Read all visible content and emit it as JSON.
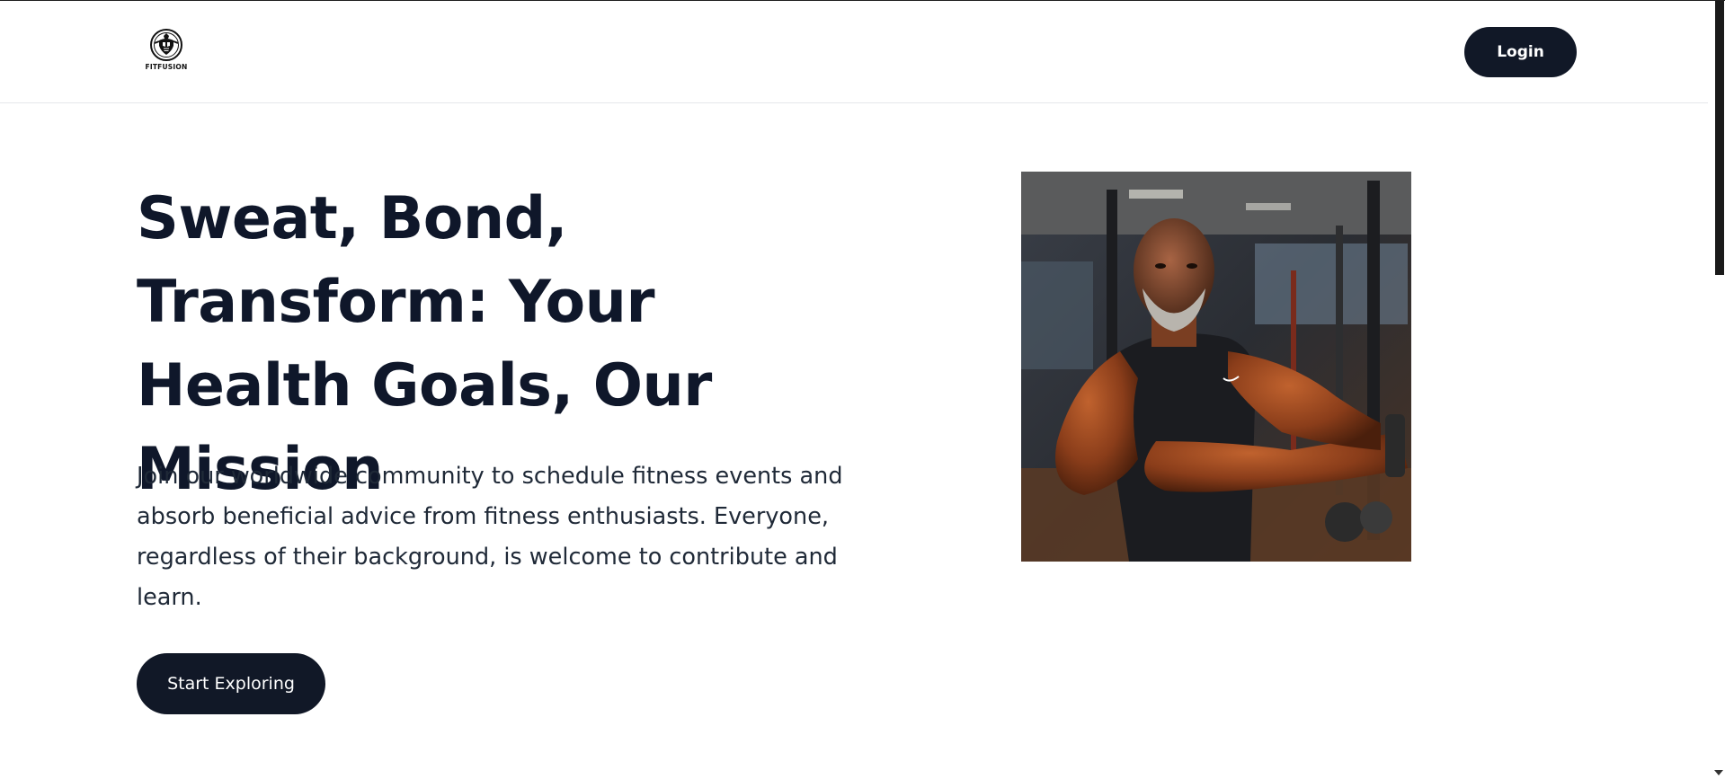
{
  "header": {
    "logo_text": "FITFUSION",
    "login_label": "Login"
  },
  "hero": {
    "title": "Sweat, Bond, Transform: Your Health Goals, Our Mission",
    "description": "Join our worldwide community to schedule fitness events and absorb beneficial advice from fitness enthusiasts. Everyone, regardless of their background, is welcome to contribute and learn.",
    "cta_label": "Start Exploring",
    "image_icon": "bodybuilder-photo"
  },
  "colors": {
    "button_bg": "#111827",
    "text_primary": "#0f172a",
    "divider": "#e5e7eb"
  }
}
